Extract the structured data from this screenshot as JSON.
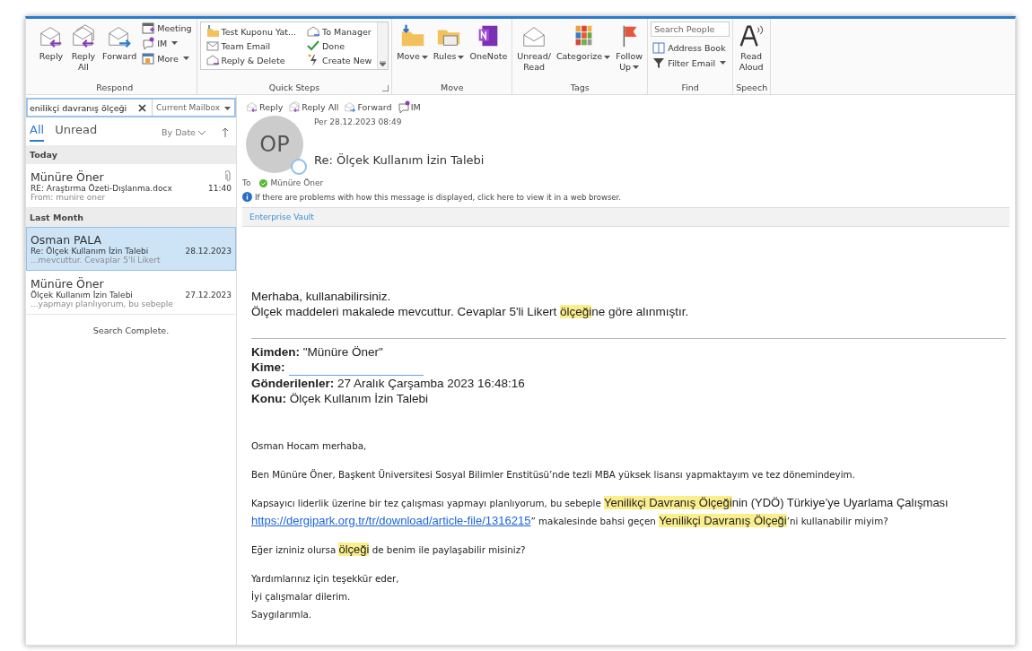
{
  "ribbon": {
    "groups": [
      {
        "kind": "respond",
        "label": "Respond",
        "buttons": [
          {
            "label": "Reply",
            "dropdown": false
          },
          {
            "label": "Reply\nAll",
            "dropdown": false
          },
          {
            "label": "Forward",
            "dropdown": false
          }
        ],
        "small_buttons": [
          {
            "label": "Meeting",
            "dropdown": false
          },
          {
            "label": "IM",
            "dropdown": true
          },
          {
            "label": "More",
            "dropdown": true
          }
        ]
      },
      {
        "kind": "quick_steps",
        "label": "Quick Steps",
        "steps": [
          "Test Kuponu Yat...",
          "To Manager",
          "Team Email",
          "Done",
          "Reply & Delete",
          "Create New"
        ]
      },
      {
        "kind": "large",
        "label": "Move",
        "buttons": [
          {
            "label": "Move",
            "dropdown": true
          },
          {
            "label": "Rules",
            "dropdown": true
          },
          {
            "label": "OneNote",
            "dropdown": false
          }
        ]
      },
      {
        "kind": "large",
        "label": "Tags",
        "buttons": [
          {
            "label": "Unread/\nRead",
            "dropdown": false
          },
          {
            "label": "Categorize",
            "dropdown": true
          },
          {
            "label": "Follow\nUp",
            "dropdown": true
          }
        ]
      },
      {
        "kind": "find",
        "label": "Find",
        "search_placeholder": "Search People",
        "small_buttons": [
          {
            "label": "Address Book",
            "dropdown": false
          },
          {
            "label": "Filter Email",
            "dropdown": true
          }
        ]
      },
      {
        "kind": "large",
        "label": "Speech",
        "buttons": [
          {
            "label": "Read\nAloud",
            "dropdown": false
          }
        ]
      }
    ]
  },
  "search": {
    "value": "enilikçi davranış ölçeği",
    "scope": "Current Mailbox"
  },
  "message_list": {
    "tabs": [
      {
        "label": "All",
        "selected": true
      },
      {
        "label": "Unread",
        "selected": false
      }
    ],
    "sort": "By Date",
    "groups": [
      {
        "header": "Today",
        "messages": [
          {
            "sender": "Münüre Öner",
            "subject": "RE: Araştırma Özeti-Dışlanma.docx",
            "date": "11:40",
            "preview": "From: munire oner",
            "attachment": true,
            "selected": false
          }
        ]
      },
      {
        "header": "Last Month",
        "messages": [
          {
            "sender": "Osman PALA",
            "subject": "Re: Ölçek Kullanım İzin Talebi",
            "date": "28.12.2023",
            "preview": "...mevcuttur. Cevaplar 5'li Likert",
            "attachment": false,
            "selected": true
          },
          {
            "sender": "Münüre Öner",
            "subject": "Ölçek Kullanım İzin Talebi",
            "date": "27.12.2023",
            "preview": "...yapmayı planlıyorum, bu sebeple",
            "attachment": false,
            "selected": false
          }
        ]
      }
    ],
    "status": "Search Complete."
  },
  "reading_pane": {
    "actions": [
      "Reply",
      "Reply All",
      "Forward",
      "IM"
    ],
    "avatar_initials": "OP",
    "date": "Per 28.12.2023 08:49",
    "subject": "Re: Ölçek Kullanım İzin Talebi",
    "to_label": "To",
    "recipient": "Münüre Öner",
    "info": "If there are problems with how this message is displayed, click here to view it in a web browser.",
    "addin": "Enterprise Vault",
    "reply": [
      [
        {
          "kind": "text",
          "text": "Merhaba, kullanabilirsiniz."
        }
      ],
      [
        {
          "kind": "text",
          "text": "Ölçek maddeleri makalede mevcuttur. Cevaplar 5'li Likert "
        },
        {
          "kind": "highlight",
          "text": "ölçeği"
        },
        {
          "kind": "text",
          "text": "ne göre alınmıştır."
        }
      ]
    ],
    "quoted_headers": [
      {
        "label": "Kimden:",
        "kind": "text",
        "value": "\"Münüre Öner\""
      },
      {
        "label": "Kime:",
        "kind": "redacted"
      },
      {
        "label": "Gönderilenler:",
        "kind": "text",
        "value": "27 Aralık Çarşamba 2023 16:48:16"
      },
      {
        "label": "Konu:",
        "kind": "text",
        "value": "Ölçek Kullanım İzin Talebi"
      }
    ],
    "paragraphs": [
      [
        {
          "kind": "text",
          "text": "Osman Hocam merhaba,"
        }
      ],
      [
        {
          "kind": "text",
          "text": "Ben Münüre Öner, Başkent Üniversitesi Sosyal Bilimler Enstitüsü’nde tezli MBA yüksek lisansı yapmaktayım ve tez dönemindeyim."
        }
      ],
      [
        {
          "kind": "text",
          "text": "Kapsayıcı liderlik üzerine bir tez çalışması yapmayı planlıyorum, bu sebeple "
        },
        {
          "kind": "highlight",
          "text": "Yenilikçi "
        },
        {
          "kind": "highlight",
          "text": "Davranış "
        },
        {
          "kind": "highlight",
          "text": "Ölçeği"
        },
        {
          "kind": "alt",
          "text": "nin (YDÖ) Türkiye’ye Uyarlama Çalışması "
        },
        {
          "kind": "link",
          "text": "https://dergipark.org.tr/tr/download/article-file/1316215"
        },
        {
          "kind": "text",
          "text": "” makalesinde bahsi geçen "
        },
        {
          "kind": "highlight",
          "text": "Yenilikçi "
        },
        {
          "kind": "highlight",
          "text": "Davranış "
        },
        {
          "kind": "highlight",
          "text": "Ölçeği"
        },
        {
          "kind": "text",
          "text": "’ni kullanabilir miyim?"
        }
      ],
      [
        {
          "kind": "text",
          "text": "Eğer izniniz olursa "
        },
        {
          "kind": "highlight",
          "text": "ölçeği"
        },
        {
          "kind": "text",
          "text": " de benim ile paylaşabilir misiniz?"
        }
      ],
      [
        {
          "kind": "text",
          "text": "Yardımlarınız için teşekkür eder,\nİyi çalışmalar dilerim.\nSaygılarımla."
        }
      ]
    ]
  }
}
